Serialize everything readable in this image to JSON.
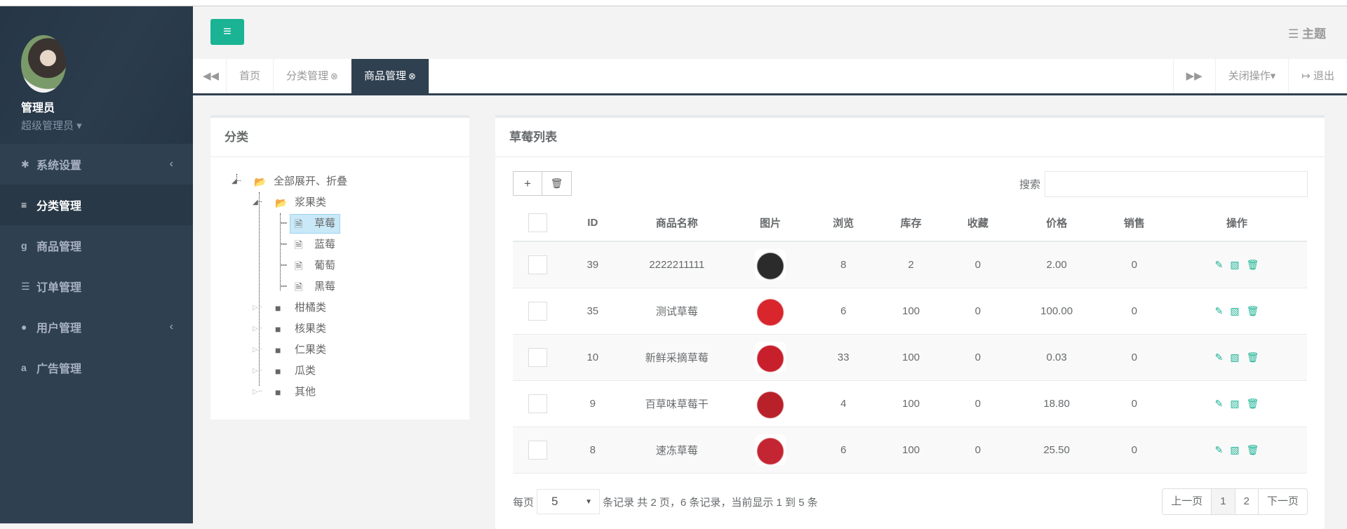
{
  "user": {
    "name": "管理员",
    "role": "超级管理员"
  },
  "sidebar": {
    "items": [
      {
        "label": "系统设置",
        "icon": "gear-icon",
        "glyph": "✱",
        "chevron": "‹"
      },
      {
        "label": "分类管理",
        "icon": "list-icon",
        "glyph": "≡",
        "active": true
      },
      {
        "label": "商品管理",
        "icon": "google-icon",
        "glyph": "g"
      },
      {
        "label": "订单管理",
        "icon": "server-icon",
        "glyph": "☰"
      },
      {
        "label": "用户管理",
        "icon": "user-icon",
        "glyph": "●",
        "chevron": "‹"
      },
      {
        "label": "广告管理",
        "icon": "amazon-icon",
        "glyph": "a"
      }
    ]
  },
  "header": {
    "menu_glyph": "≡",
    "theme": "主题",
    "theme_glyph": "☰"
  },
  "tabs": {
    "prev": "◀◀",
    "next": "▶▶",
    "items": [
      "首页",
      "分类管理",
      "商品管理"
    ],
    "close_glyph": "⊗",
    "close_ops": "关闭操作",
    "logout": "退出",
    "logout_glyph": "↦"
  },
  "tree": {
    "title": "分类",
    "root": "全部展开、折叠",
    "berries": "浆果类",
    "leaves": [
      "草莓",
      "蓝莓",
      "葡萄",
      "黑莓"
    ],
    "others": [
      "柑橘类",
      "核果类",
      "仁果类",
      "瓜类",
      "其他"
    ]
  },
  "list": {
    "title": "草莓列表",
    "add": "+",
    "delete": "🗑",
    "search_label": "搜索",
    "search_value": "",
    "columns": [
      "ID",
      "商品名称",
      "图片",
      "浏览",
      "库存",
      "收藏",
      "价格",
      "销售",
      "操作"
    ],
    "rows": [
      {
        "id": "39",
        "name": "2222211111",
        "views": "8",
        "stock": "2",
        "fav": "0",
        "price": "2.00",
        "sales": "0",
        "img": "#2b2b2b"
      },
      {
        "id": "35",
        "name": "测试草莓",
        "views": "6",
        "stock": "100",
        "fav": "0",
        "price": "100.00",
        "sales": "0",
        "img": "#d8262c"
      },
      {
        "id": "10",
        "name": "新鲜采摘草莓",
        "views": "33",
        "stock": "100",
        "fav": "0",
        "price": "0.03",
        "sales": "0",
        "img": "#c81f2c"
      },
      {
        "id": "9",
        "name": "百草味草莓干",
        "views": "4",
        "stock": "100",
        "fav": "0",
        "price": "18.80",
        "sales": "0",
        "img": "#b8202a"
      },
      {
        "id": "8",
        "name": "速冻草莓",
        "views": "6",
        "stock": "100",
        "fav": "0",
        "price": "25.50",
        "sales": "0",
        "img": "#c42532"
      }
    ]
  },
  "pager": {
    "per_page": "每页",
    "size": "5",
    "info": "条记录 共 2 页，6 条记录，当前显示 1 到 5 条",
    "prev": "上一页",
    "pages": [
      "1",
      "2"
    ],
    "next": "下一页"
  }
}
